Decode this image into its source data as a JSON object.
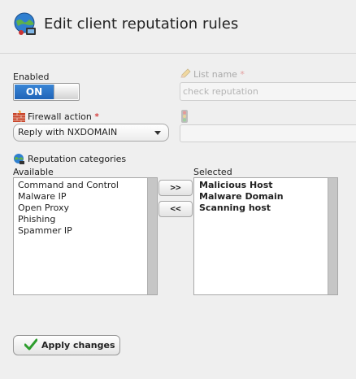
{
  "header": {
    "title": "Edit client reputation rules",
    "icon": "globe-network-icon"
  },
  "form": {
    "enabled": {
      "label": "Enabled",
      "toggle_state": "ON"
    },
    "list_name": {
      "label": "List name",
      "required_mark": "*",
      "value": "check reputation",
      "icon": "pencil-icon"
    },
    "firewall_action": {
      "label": "Firewall action",
      "required_mark": "*",
      "selected": "Reply with NXDOMAIN",
      "icon": "firewall-icon"
    },
    "traffic_light": {
      "icon": "traffic-light-icon"
    },
    "reputation_categories": {
      "label": "Reputation categories",
      "icon": "globe-network-icon",
      "available_label": "Available",
      "selected_label": "Selected",
      "available": [
        "Command and Control",
        "Malware IP",
        "Open Proxy",
        "Phishing",
        "Spammer IP"
      ],
      "selected": [
        "Malicious Host",
        "Malware Domain",
        "Scanning host"
      ],
      "add_button": ">>",
      "remove_button": "<<"
    }
  },
  "actions": {
    "apply_label": "Apply changes"
  },
  "colors": {
    "toggle_on": "#2a74c9",
    "required": "#cc0000",
    "check": "#2e9e2e"
  }
}
